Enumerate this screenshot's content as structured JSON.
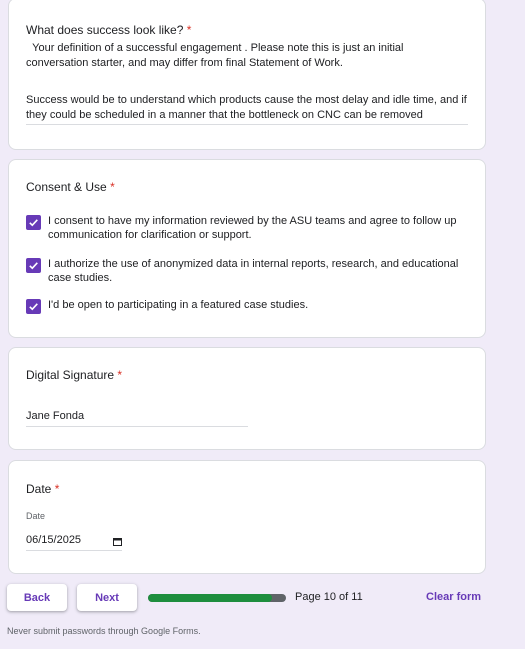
{
  "colors": {
    "background": "#f0ebf8",
    "accent": "#673ab7",
    "required": "#d93025",
    "progress_fill": "#1e8e3e",
    "progress_track": "#5f6368"
  },
  "success": {
    "title": "What does success look like?",
    "required_mark": "*",
    "description": "  Your definition of a successful engagement . Please note this is just an initial conversation starter, and may differ from final Statement of Work.",
    "answer": "Success would be to understand which products cause the most delay and idle time, and if they could be scheduled in a manner that the bottleneck on CNC can be removed"
  },
  "consent": {
    "title": "Consent & Use",
    "required_mark": "*",
    "options": [
      {
        "label": "I consent to have my information reviewed by the ASU teams and agree to follow up communication for clarification or support.",
        "checked": true
      },
      {
        "label": "I authorize the use of anonymized data in internal reports, research, and educational case studies.",
        "checked": true
      },
      {
        "label": "I'd be open to participating in a featured case studies.",
        "checked": true
      }
    ]
  },
  "signature": {
    "title": "Digital Signature",
    "required_mark": "*",
    "value": "Jane Fonda"
  },
  "date": {
    "title": "Date",
    "required_mark": "*",
    "field_label": "Date",
    "value": "06/15/2025",
    "icon": "calendar-icon"
  },
  "navigation": {
    "back_label": "Back",
    "next_label": "Next",
    "page_text": "Page 10 of 11",
    "progress_fraction": 0.9,
    "clear_label": "Clear form"
  },
  "footer": {
    "note": "Never submit passwords through Google Forms."
  }
}
